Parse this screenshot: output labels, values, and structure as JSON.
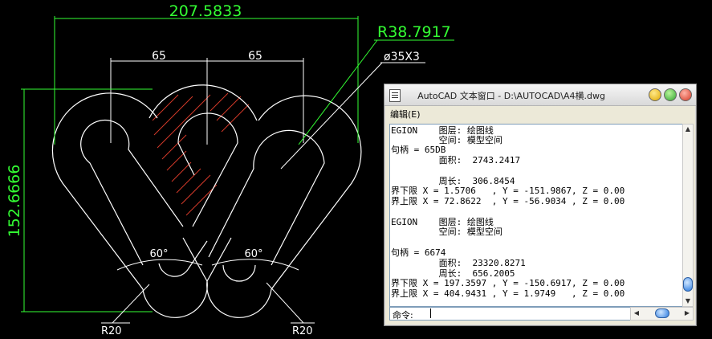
{
  "drawing": {
    "dim_width": "207.5833",
    "dim_height": "152.6666",
    "dim_left_65": "65",
    "dim_right_65": "65",
    "radius_big": "R38.7917",
    "hole_label": "ø35X3",
    "angle_left": "60°",
    "angle_right": "60°",
    "r20_left": "R20",
    "r20_right": "R20",
    "colors": {
      "background": "#000000",
      "geometry": "#ffffff",
      "dimension": "#33ff33",
      "hatch": "#d43a2a"
    }
  },
  "text_window": {
    "title": "AutoCAD 文本窗口 - D:\\AUTOCAD\\A4横.dwg",
    "menu_edit": "编辑(E)",
    "lines": [
      "EGION    图层: 绘图线",
      "         空间: 模型空间",
      "句柄 = 65DB",
      "         面积:  2743.2417",
      "",
      "         周长:  306.8454",
      "界下限 X = 1.5706   , Y = -151.9867, Z = 0.00",
      "界上限 X = 72.8622  , Y = -56.9034 , Z = 0.00",
      "",
      "EGION    图层: 绘图线",
      "         空间: 模型空间",
      "",
      "句柄 = 6674",
      "         面积:  23320.8271",
      "         周长:  656.2005",
      "界下限 X = 197.3597 , Y = -150.6917, Z = 0.00",
      "界上限 X = 404.9431 , Y = 1.9749   , Z = 0.00"
    ],
    "command_label": "命令:",
    "command_value": ""
  }
}
